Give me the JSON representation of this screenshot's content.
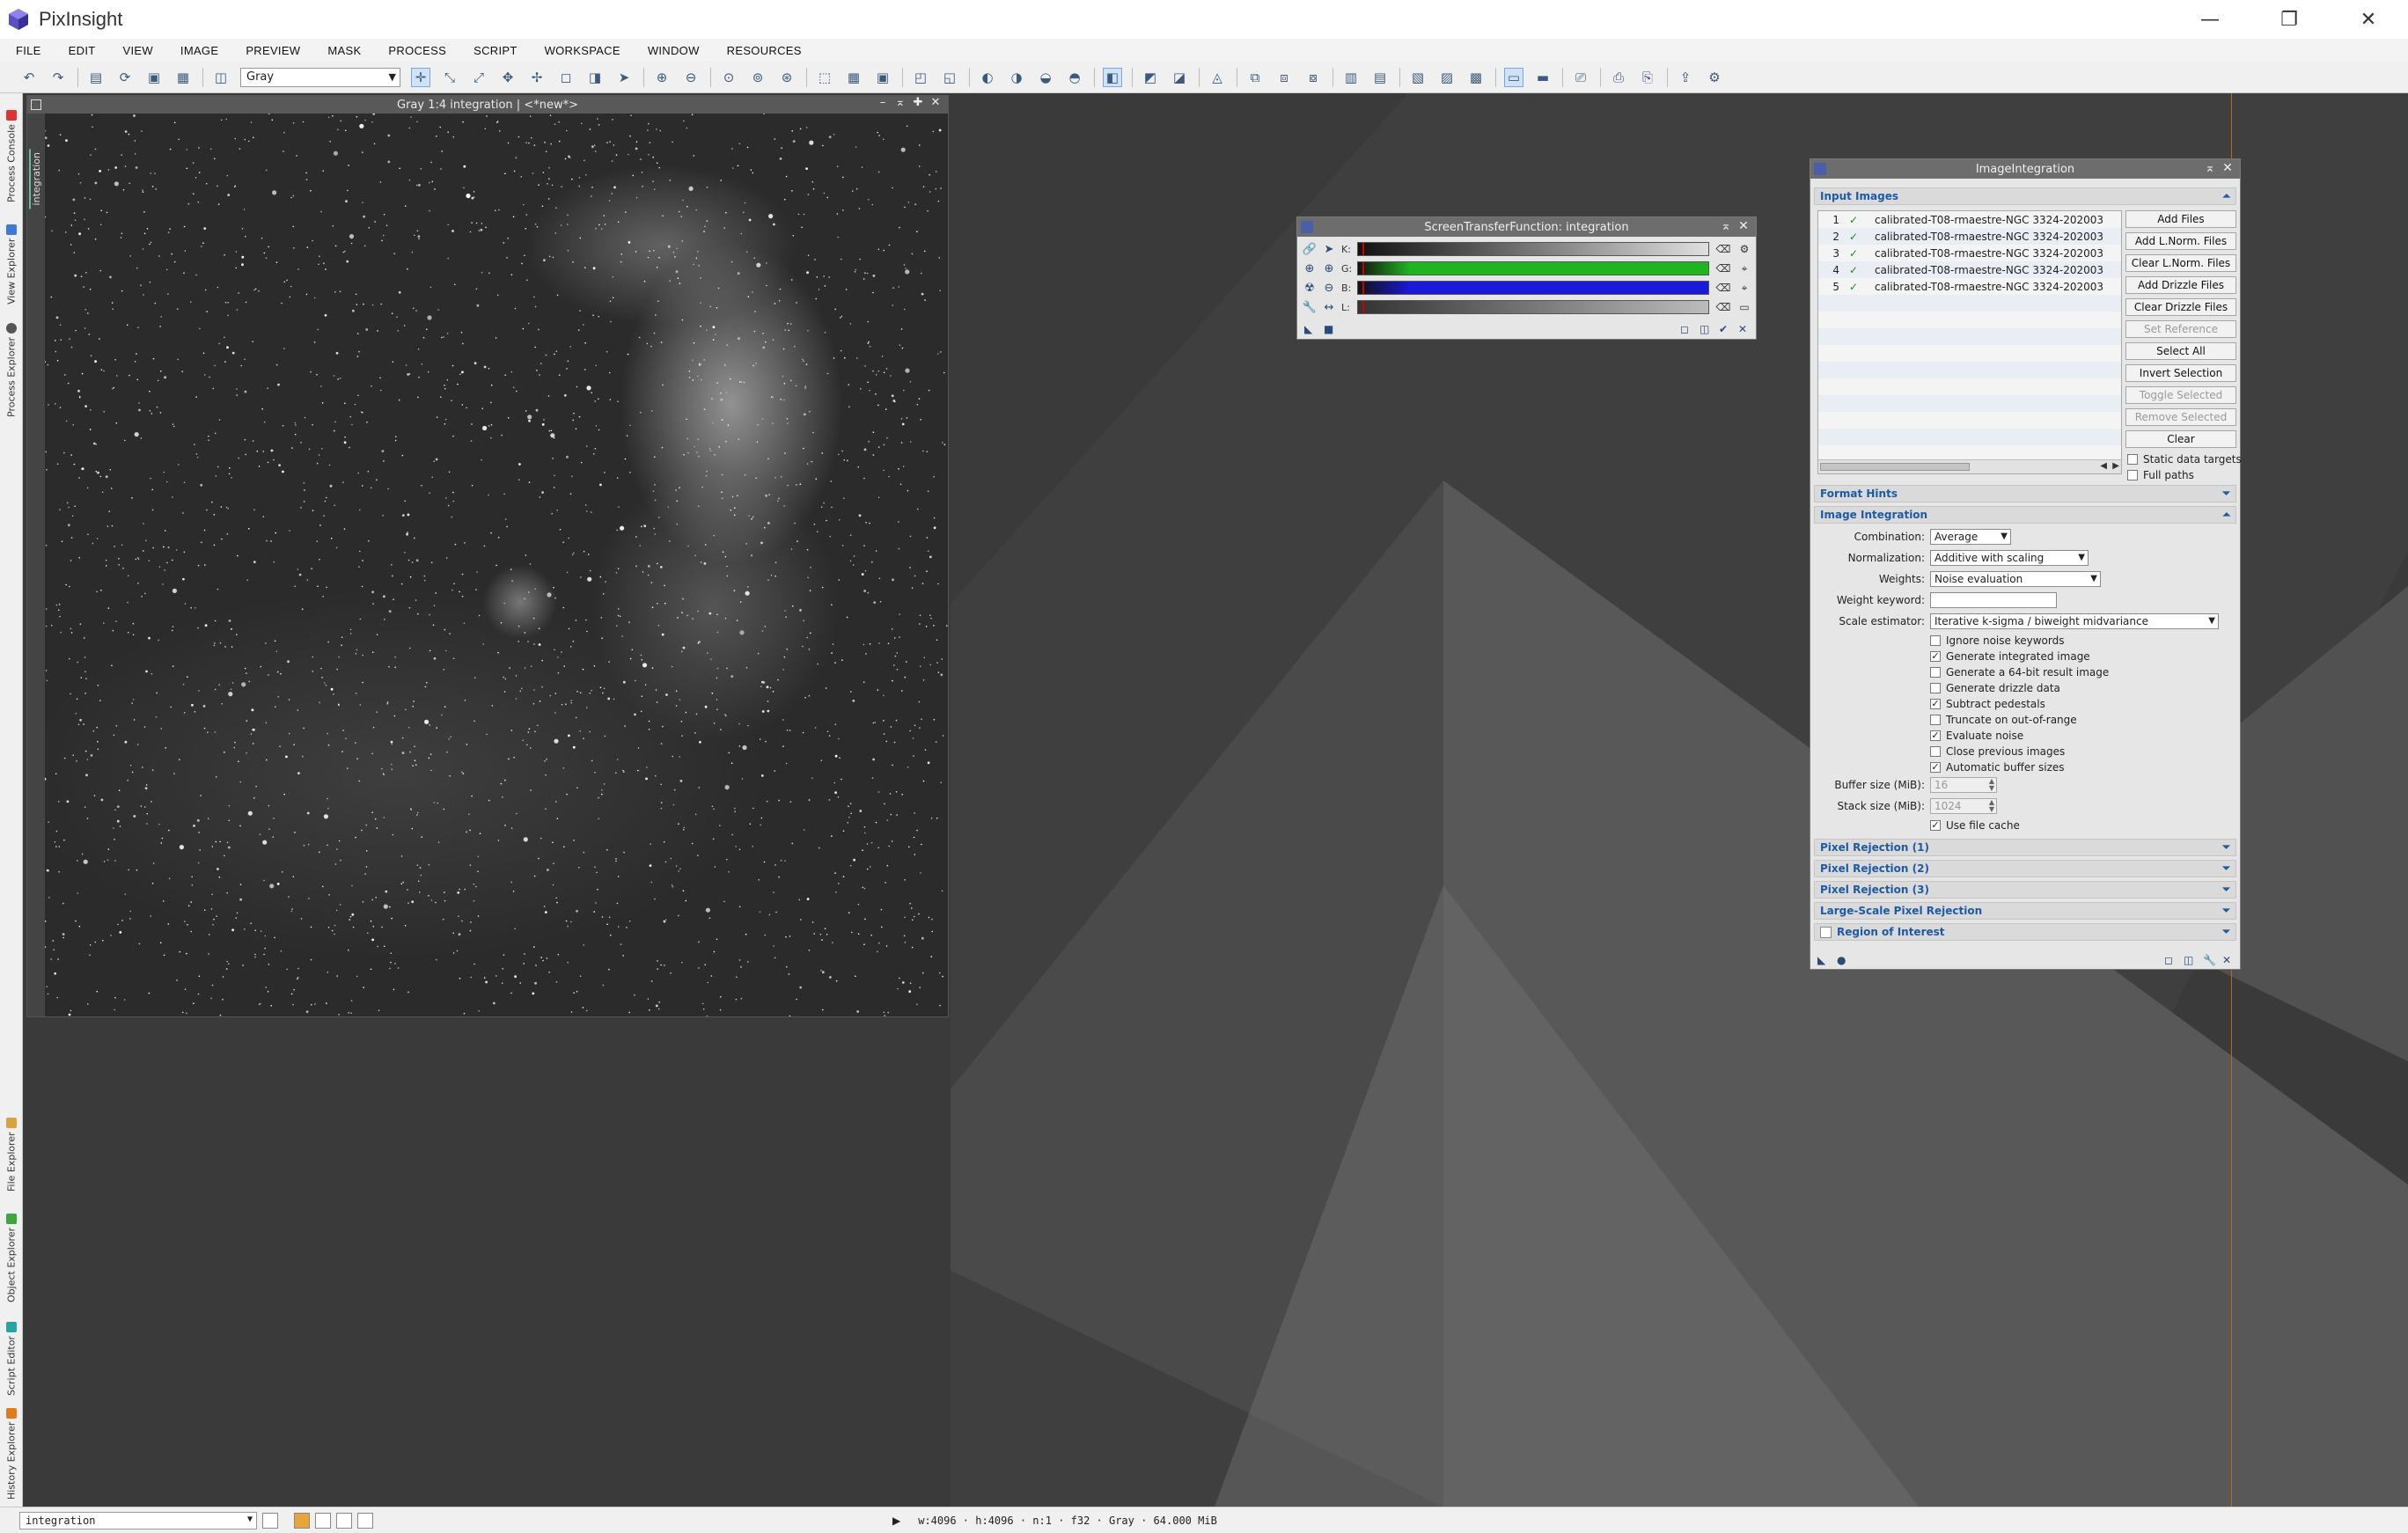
{
  "app": {
    "title": "PixInsight",
    "minimize": "—",
    "restore": "❐",
    "close": "✕"
  },
  "menubar": [
    "FILE",
    "EDIT",
    "VIEW",
    "IMAGE",
    "PREVIEW",
    "MASK",
    "PROCESS",
    "SCRIPT",
    "WORKSPACE",
    "WINDOW",
    "RESOURCES"
  ],
  "toolbar": {
    "colorspace_value": "Gray"
  },
  "left_dock_tabs": [
    "Process Console",
    "View Explorer",
    "Process Explorer",
    "File Explorer",
    "Object Explorer",
    "Script Editor",
    "History Explorer"
  ],
  "image_window": {
    "title": "Gray 1:4 integration | <*new*>",
    "side_tag": "integration"
  },
  "stf": {
    "title": "ScreenTransferFunction: integration",
    "channels": [
      {
        "label": "K:",
        "color": "#d0d0d0"
      },
      {
        "label": "G:",
        "color": "#22b522"
      },
      {
        "label": "B:",
        "color": "#1a1ad8"
      },
      {
        "label": "L:",
        "color": "#bcbcbc"
      }
    ]
  },
  "image_integration": {
    "title": "ImageIntegration",
    "sections": {
      "input_images": "Input Images",
      "format_hints": "Format Hints",
      "image_integration": "Image Integration",
      "pixel_rejection_1": "Pixel Rejection (1)",
      "pixel_rejection_2": "Pixel Rejection (2)",
      "pixel_rejection_3": "Pixel Rejection (3)",
      "large_scale": "Large-Scale Pixel Rejection",
      "roi": "Region of Interest"
    },
    "files": [
      {
        "n": "1",
        "check": "✓",
        "name": "calibrated-T08-rmaestre-NGC 3324-202003"
      },
      {
        "n": "2",
        "check": "✓",
        "name": "calibrated-T08-rmaestre-NGC 3324-202003"
      },
      {
        "n": "3",
        "check": "✓",
        "name": "calibrated-T08-rmaestre-NGC 3324-202003"
      },
      {
        "n": "4",
        "check": "✓",
        "name": "calibrated-T08-rmaestre-NGC 3324-202003"
      },
      {
        "n": "5",
        "check": "✓",
        "name": "calibrated-T08-rmaestre-NGC 3324-202003"
      }
    ],
    "buttons": {
      "add_files": "Add Files",
      "add_lnorm": "Add L.Norm. Files",
      "clear_lnorm": "Clear L.Norm. Files",
      "add_drizzle": "Add Drizzle Files",
      "clear_drizzle": "Clear Drizzle Files",
      "set_reference": "Set Reference",
      "select_all": "Select All",
      "invert_selection": "Invert Selection",
      "toggle_selected": "Toggle Selected",
      "remove_selected": "Remove Selected",
      "clear": "Clear"
    },
    "list_options": {
      "static_targets": "Static data targets",
      "full_paths": "Full paths"
    },
    "form": {
      "combination_label": "Combination:",
      "combination_value": "Average",
      "normalization_label": "Normalization:",
      "normalization_value": "Additive with scaling",
      "weights_label": "Weights:",
      "weights_value": "Noise evaluation",
      "weight_keyword_label": "Weight keyword:",
      "scale_estimator_label": "Scale estimator:",
      "scale_estimator_value": "Iterative k-sigma / biweight midvariance",
      "buffer_label": "Buffer size (MiB):",
      "buffer_value": "16",
      "stack_label": "Stack size (MiB):",
      "stack_value": "1024"
    },
    "checkboxes": [
      {
        "label": "Ignore noise keywords",
        "checked": false
      },
      {
        "label": "Generate integrated image",
        "checked": true
      },
      {
        "label": "Generate a 64-bit result image",
        "checked": false
      },
      {
        "label": "Generate drizzle data",
        "checked": false
      },
      {
        "label": "Subtract pedestals",
        "checked": true
      },
      {
        "label": "Truncate on out-of-range",
        "checked": false
      },
      {
        "label": "Evaluate noise",
        "checked": true
      },
      {
        "label": "Close previous images",
        "checked": false
      },
      {
        "label": "Automatic buffer sizes",
        "checked": true
      }
    ],
    "use_file_cache": {
      "label": "Use file cache",
      "checked": true
    }
  },
  "statusbar": {
    "view": "integration",
    "info": "w:4096 · h:4096 · n:1 · f32 · Gray · 64.000 MiB"
  }
}
